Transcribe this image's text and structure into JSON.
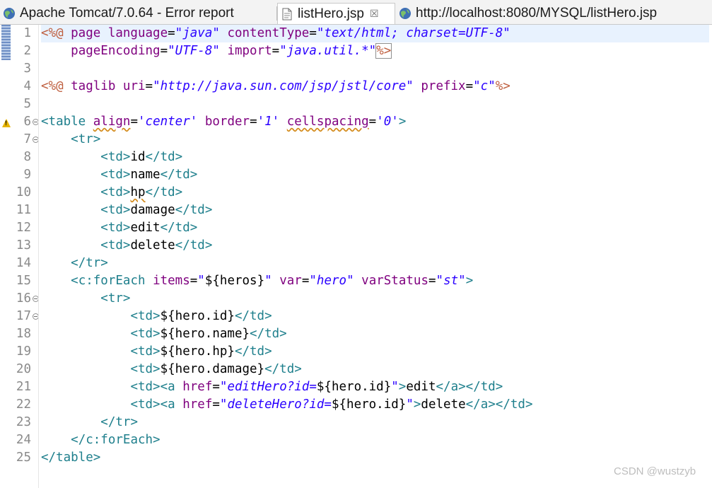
{
  "tabs": [
    {
      "title": "Apache Tomcat/7.0.64 - Error report",
      "icon": "globe-icon"
    },
    {
      "title": "listHero.jsp",
      "icon": "jsp-file-icon",
      "close": "☒"
    },
    {
      "title": "http://localhost:8080/MYSQL/listHero.jsp",
      "icon": "globe-icon"
    }
  ],
  "line_numbers": [
    "1",
    "2",
    "3",
    "4",
    "5",
    "6",
    "7",
    "8",
    "9",
    "10",
    "11",
    "12",
    "13",
    "14",
    "15",
    "16",
    "17",
    "18",
    "19",
    "20",
    "21",
    "22",
    "23",
    "24",
    "25"
  ],
  "code": {
    "l1": [
      "<%@",
      " page ",
      "language",
      "=",
      "\"java\"",
      " ",
      "contentType",
      "=",
      "\"text/html; charset=UTF-8\""
    ],
    "l2": [
      "    ",
      "pageEncoding",
      "=",
      "\"UTF-8\"",
      " ",
      "import",
      "=",
      "\"java.util.*\"",
      "%>"
    ],
    "l4": [
      "<%@",
      " taglib ",
      "uri",
      "=",
      "\"http://java.sun.com/jsp/jstl/core\"",
      " ",
      "prefix",
      "=",
      "\"c\"",
      "%>"
    ],
    "l6": [
      "<table",
      " ",
      "align",
      "=",
      "'center'",
      " ",
      "border",
      "=",
      "'1'",
      " ",
      "cellspacing",
      "=",
      "'0'",
      ">"
    ],
    "l7": [
      "    ",
      "<tr>"
    ],
    "l8": [
      "        ",
      "<td>",
      "id",
      "</td>"
    ],
    "l9": [
      "        ",
      "<td>",
      "name",
      "</td>"
    ],
    "l10": [
      "        ",
      "<td>",
      "hp",
      "</td>"
    ],
    "l11": [
      "        ",
      "<td>",
      "damage",
      "</td>"
    ],
    "l12": [
      "        ",
      "<td>",
      "edit",
      "</td>"
    ],
    "l13": [
      "        ",
      "<td>",
      "delete",
      "</td>"
    ],
    "l14": [
      "    ",
      "</tr>"
    ],
    "l15": [
      "    ",
      "<c:forEach",
      " ",
      "items",
      "=",
      "\"",
      "${heros}",
      "\"",
      " ",
      "var",
      "=",
      "\"hero\"",
      " ",
      "varStatus",
      "=",
      "\"st\"",
      ">"
    ],
    "l16": [
      "        ",
      "<tr>"
    ],
    "l17": [
      "            ",
      "<td>",
      "${hero.id}",
      "</td>"
    ],
    "l18": [
      "            ",
      "<td>",
      "${hero.name}",
      "</td>"
    ],
    "l19": [
      "            ",
      "<td>",
      "${hero.hp}",
      "</td>"
    ],
    "l20": [
      "            ",
      "<td>",
      "${hero.damage}",
      "</td>"
    ],
    "l21": [
      "            ",
      "<td>",
      "<a",
      " ",
      "href",
      "=",
      "\"editHero?id=",
      "${hero.id}",
      "\"",
      ">",
      "edit",
      "</a>",
      "</td>"
    ],
    "l22": [
      "            ",
      "<td>",
      "<a",
      " ",
      "href",
      "=",
      "\"deleteHero?id=",
      "${hero.id}",
      "\"",
      ">",
      "delete",
      "</a>",
      "</td>"
    ],
    "l23": [
      "        ",
      "</tr>"
    ],
    "l24": [
      "    ",
      "</c:forEach>"
    ],
    "l25": [
      "</table>"
    ]
  },
  "watermark": "CSDN @wustzyb",
  "colors": {
    "tag": "#1e7f8c",
    "attr": "#7f007f",
    "string": "#2a00ff",
    "directive": "#bf5f3f",
    "current_line": "#e8f2fe"
  }
}
